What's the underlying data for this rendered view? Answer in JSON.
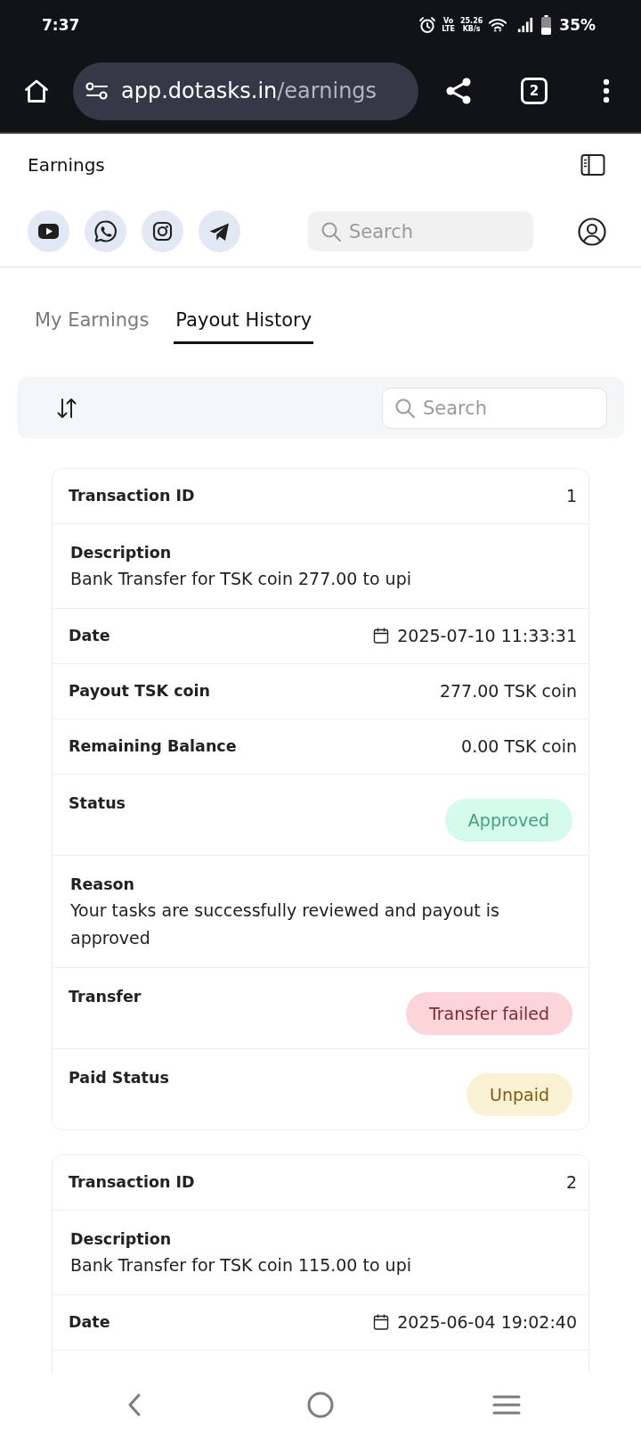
{
  "status_bar": {
    "time": "7:37",
    "volte": [
      "Vo",
      "LTE"
    ],
    "net_speed": [
      "25.26",
      "KB/s"
    ],
    "battery": "35%"
  },
  "browser": {
    "url": {
      "host": "app.dotasks.in",
      "path": "/earnings"
    },
    "tab_count": "2"
  },
  "app_header": {
    "title": "Earnings",
    "search": {
      "placeholder": "Search"
    }
  },
  "tabs": [
    {
      "label": "My Earnings",
      "selected": false
    },
    {
      "label": "Payout History",
      "selected": true
    }
  ],
  "toolbar": {
    "search": {
      "placeholder": "Search"
    }
  },
  "payouts": [
    {
      "continues": false,
      "rows": [
        {
          "kind": "inline",
          "label": "Transaction ID",
          "value": "1"
        },
        {
          "kind": "stacked",
          "label": "Description",
          "value": "Bank Transfer for TSK coin 277.00 to upi"
        },
        {
          "kind": "date",
          "label": "Date",
          "value": "2025-07-10 11:33:31"
        },
        {
          "kind": "inline",
          "label": "Payout TSK coin",
          "value": "277.00 TSK coin"
        },
        {
          "kind": "inline",
          "label": "Remaining Balance",
          "value": "0.00 TSK coin"
        },
        {
          "kind": "badge",
          "label": "Status",
          "value": "Approved",
          "color": "#46a07c"
        },
        {
          "kind": "stacked",
          "label": "Reason",
          "value": "Your tasks are successfully reviewed and payout is approved"
        },
        {
          "kind": "badge",
          "label": "Transfer",
          "value": "Transfer failed",
          "color": "#7c2a33"
        },
        {
          "kind": "badge",
          "label": "Paid Status",
          "value": "Unpaid",
          "color": "#7a5e10"
        }
      ]
    },
    {
      "continues": true,
      "rows": [
        {
          "kind": "inline",
          "label": "Transaction ID",
          "value": "2"
        },
        {
          "kind": "stacked",
          "label": "Description",
          "value": "Bank Transfer for TSK coin 115.00 to upi"
        },
        {
          "kind": "date",
          "label": "Date",
          "value": "2025-06-04 19:02:40"
        }
      ]
    }
  ]
}
